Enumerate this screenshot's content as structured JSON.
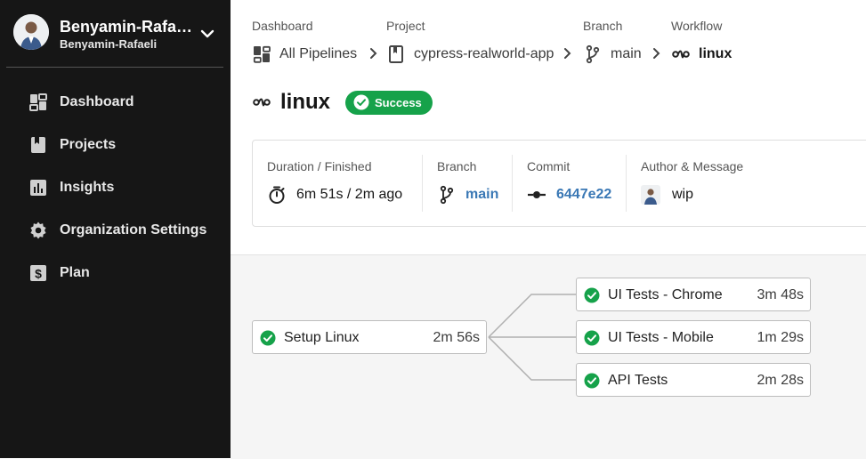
{
  "user": {
    "name": "Benyamin-Rafaeli",
    "org": "Benyamin-Rafaeli"
  },
  "nav": [
    {
      "label": "Dashboard",
      "icon": "dashboard-icon"
    },
    {
      "label": "Projects",
      "icon": "projects-icon"
    },
    {
      "label": "Insights",
      "icon": "insights-icon"
    },
    {
      "label": "Organization Settings",
      "icon": "gear-icon"
    },
    {
      "label": "Plan",
      "icon": "dollar-icon"
    }
  ],
  "breadcrumb": {
    "dashboard": {
      "head": "Dashboard",
      "value": "All Pipelines"
    },
    "project": {
      "head": "Project",
      "value": "cypress-realworld-app"
    },
    "branch": {
      "head": "Branch",
      "value": "main"
    },
    "workflow": {
      "head": "Workflow",
      "value": "linux"
    }
  },
  "workflow": {
    "title": "linux",
    "status": "Success"
  },
  "details": {
    "duration": {
      "label": "Duration / Finished",
      "value": "6m 51s / 2m ago"
    },
    "branch": {
      "label": "Branch",
      "value": "main"
    },
    "commit": {
      "label": "Commit",
      "value": "6447e22"
    },
    "author": {
      "label": "Author & Message",
      "value": "wip"
    }
  },
  "jobs": {
    "setup": {
      "name": "Setup Linux",
      "duration": "2m 56s",
      "status": "success"
    },
    "chrome": {
      "name": "UI Tests - Chrome",
      "duration": "3m 48s",
      "status": "success"
    },
    "mobile": {
      "name": "UI Tests - Mobile",
      "duration": "1m 29s",
      "status": "success"
    },
    "api": {
      "name": "API Tests",
      "duration": "2m 28s",
      "status": "success"
    }
  },
  "colors": {
    "success": "#16a24a",
    "link": "#3a78b5",
    "sidebar": "#161616"
  }
}
